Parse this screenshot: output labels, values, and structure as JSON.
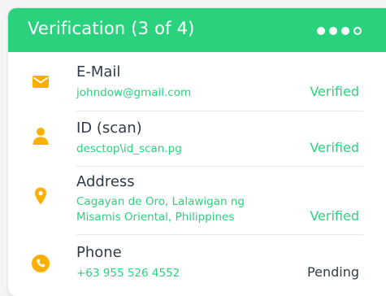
{
  "header": {
    "title": "Verification (3 of 4)",
    "accent_color": "#2bd27e",
    "step_indicator": {
      "total": 4,
      "completed": 3
    }
  },
  "items": [
    {
      "icon": "mail-icon",
      "title": "E-Mail",
      "detail_lines": [
        "johndow@gmail.com"
      ],
      "status": "Verified"
    },
    {
      "icon": "person-icon",
      "title": "ID (scan)",
      "detail_lines": [
        "desctop\\id_scan.pg"
      ],
      "status": "Verified"
    },
    {
      "icon": "location-pin-icon",
      "title": "Address",
      "detail_lines": [
        "Cagayan de Oro, Lalawigan ng",
        "Misamis Oriental, Philippines"
      ],
      "status": "Verified"
    },
    {
      "icon": "phone-icon",
      "title": "Phone",
      "detail_lines": [
        "+63 955 526 4552"
      ],
      "status": "Pending"
    }
  ],
  "colors": {
    "icon": "#fbb000",
    "verified": "#2bd27e",
    "pending": "#2f3b48"
  }
}
